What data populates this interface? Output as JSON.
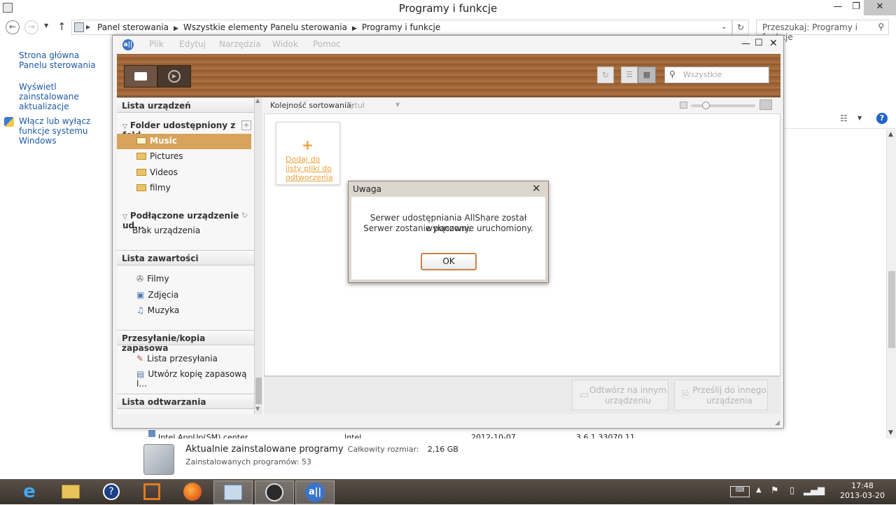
{
  "explorer": {
    "title": "Programy i funkcje",
    "breadcrumbs": [
      "Panel sterowania",
      "Wszystkie elementy Panelu sterowania",
      "Programy i funkcje"
    ],
    "search_placeholder": "Przeszukaj: Programy i funkcje",
    "left_links": [
      "Strona główna Panelu sterowania",
      "Wyświetl zainstalowane aktualizacje",
      "Włącz lub wyłącz funkcje systemu Windows"
    ],
    "partial_row": {
      "name": "Intel AppUp(SM) center",
      "publisher": "Intel",
      "date": "2012-10-07",
      "version": "3.6.1.33070.11"
    },
    "summary_title": "Aktualnie zainstalowane programy",
    "total_size_label": "Całkowity rozmiar:",
    "total_size_value": "2,16 GB",
    "installed_count": "Zainstalowanych programów: 53"
  },
  "allshare": {
    "menu": [
      "Plik",
      "Edytuj",
      "Narzędzia",
      "Widok",
      "Pomoc"
    ],
    "search_placeholder": "Wszystkie",
    "devices_header": "Lista urządzeń",
    "shared_folder_label": "Folder udostępniony z fold...",
    "folders": [
      "Music",
      "Pictures",
      "Videos",
      "filmy"
    ],
    "connected_label": "Podłączone urządzenie ud...",
    "no_device": "Brak urządzenia",
    "content_header": "Lista zawartości",
    "content_items": [
      "Filmy",
      "Zdjęcia",
      "Muzyka"
    ],
    "transfer_header": "Przesyłanie/kopia zapasowa",
    "transfer_items": [
      "Lista przesyłania",
      "Utwórz kopię zapasową l..."
    ],
    "playlist_header": "Lista odtwarzania",
    "sort_label": "Kolejność sortowania:",
    "sort_value": "Tytuł",
    "add_tile_label": "Dodaj do listy pliki do odtworzenia",
    "play_other_label": "Odtwórz na innym urządzeniu",
    "send_other_label": "Prześlij do innego urządzenia"
  },
  "dialog": {
    "title": "Uwaga",
    "line1": "Serwer udostępniania AllShare został wyłączony.",
    "line2": "Serwer zostanie ponownie uruchomiony.",
    "ok": "OK"
  },
  "taskbar": {
    "time": "17:48",
    "date": "2013-03-20"
  },
  "colors": {
    "accent_orange": "#e9a23b",
    "selected_row": "#d8a35b",
    "link_blue": "#1e5aa8"
  }
}
